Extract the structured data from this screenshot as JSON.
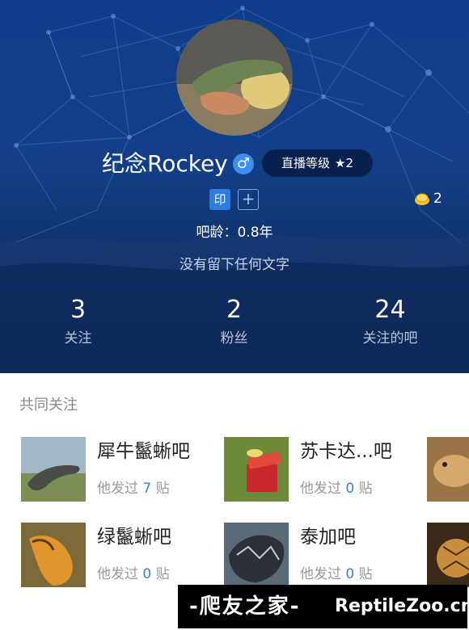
{
  "profile": {
    "username": "纪念Rockey",
    "gender_icon": "male-icon",
    "gender_symbol": "♂",
    "live_level_label": "直播等级",
    "live_level_star": "★",
    "live_level_value": "2",
    "seal_badge": "印",
    "add_badge": "+",
    "coin_icon": "gold-coin-icon",
    "coin_count": "2",
    "age_text": "吧龄：0.8年",
    "bio": "没有留下任何文字"
  },
  "stats": [
    {
      "value": "3",
      "label": "关注"
    },
    {
      "value": "2",
      "label": "粉丝"
    },
    {
      "value": "24",
      "label": "关注的吧"
    }
  ],
  "common": {
    "title": "共同关注",
    "posts_prefix": "他发过",
    "posts_suffix": "贴",
    "bars": [
      {
        "name": "犀牛鬣蜥吧",
        "posts": "7"
      },
      {
        "name": "苏卡达...吧",
        "posts": "0"
      },
      {
        "name": "绿鬣蜥吧",
        "posts": "0"
      },
      {
        "name": "泰加吧",
        "posts": "0"
      }
    ]
  },
  "watermark": {
    "cn": "-爬友之家-",
    "en": "ReptileZoo.cn"
  },
  "colors": {
    "header_top": "#0e3d8c",
    "header_bottom": "#0a1e44",
    "accent_blue": "#3a7fd5"
  }
}
